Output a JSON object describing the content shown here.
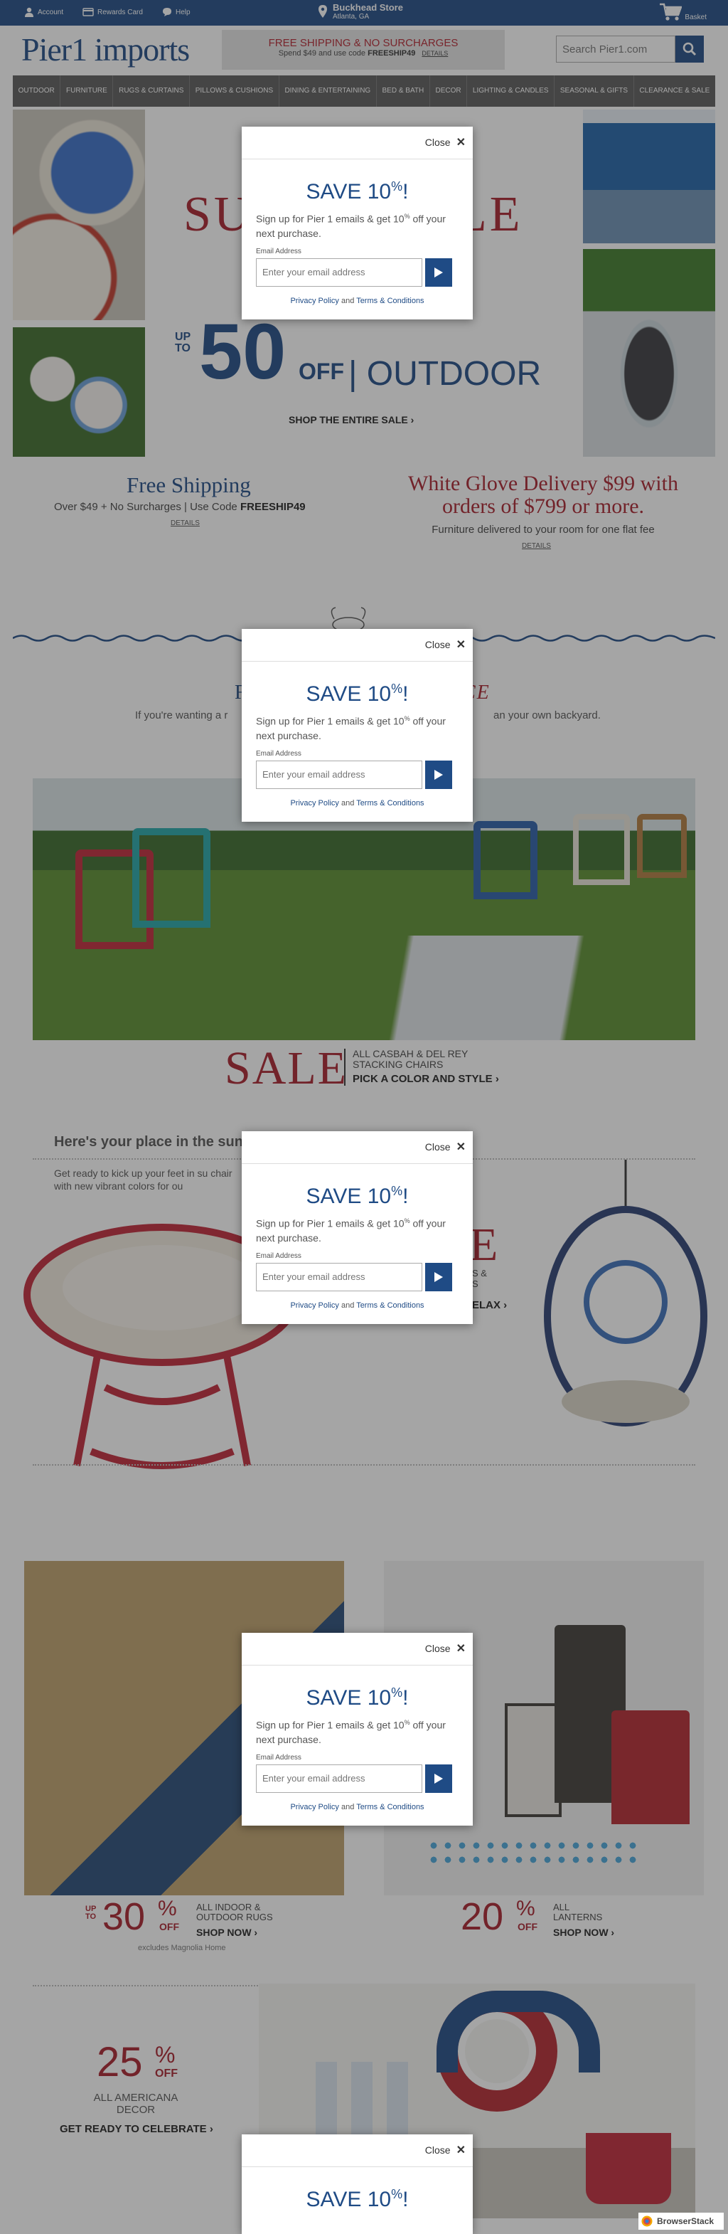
{
  "utilbar": {
    "account": "Account",
    "rewards": "Rewards Card",
    "help": "Help",
    "store_name": "Buckhead Store",
    "store_city": "Atlanta, GA",
    "basket": "Basket"
  },
  "header": {
    "logo": "Pier1 imports",
    "promo_line1": "FREE SHIPPING & NO SURCHARGES",
    "promo_line2_pre": "Spend $49 and use code",
    "promo_code": "FREESHIP49",
    "promo_details": "DETAILS",
    "search_placeholder": "Search Pier1.com"
  },
  "nav": [
    "OUTDOOR",
    "FURNITURE",
    "RUGS & CURTAINS",
    "PILLOWS & CUSHIONS",
    "DINING & ENTERTAINING",
    "BED & BATH",
    "DECOR",
    "LIGHTING & CANDLES",
    "SEASONAL & GIFTS",
    "CLEARANCE & SALE"
  ],
  "hero": {
    "word_left": "SU",
    "word_right": "LE",
    "up_to": "UP TO",
    "amount": "50",
    "off": "OFF",
    "category": "| OUTDOOR",
    "cta": "SHOP THE ENTIRE SALE ›"
  },
  "shipping": {
    "title": "Free Shipping",
    "sub_pre": "Over $49 + No Surcharges | Use Code",
    "code": "FREESHIP49",
    "details": "DETAILS"
  },
  "white_glove": {
    "title": "White Glove Delivery $99 with orders of $799 or more.",
    "sub": "Furniture delivered to your room for one flat fee",
    "details": "DETAILS"
  },
  "section2": {
    "title_a": "F",
    "title_b": "CE",
    "sub_left": "If you're wanting a r",
    "sub_right": "an your own backyard."
  },
  "chairs_sale": {
    "big": "SALE",
    "line1": "ALL CASBAH & DEL REY",
    "line2": "STACKING CHAIRS",
    "cta": "PICK A COLOR AND STYLE ›"
  },
  "sun": {
    "title": "Here's your place in the sun.",
    "sub": "Get ready to kick up your feet in su chair with new vibrant colors for ou",
    "promo_big": "E",
    "promo_l1": "S &",
    "promo_l2": "S",
    "promo_cta": "ELAX ›"
  },
  "rugs": {
    "up_to": "UP TO",
    "amount": "30",
    "pct": "%",
    "off": "OFF",
    "category": "ALL INDOOR & OUTDOOR RUGS",
    "cta": "SHOP NOW ›",
    "exclusion": "excludes Magnolia Home"
  },
  "lanterns": {
    "amount": "20",
    "pct": "%",
    "off": "OFF",
    "category": "ALL LANTERNS",
    "cta": "SHOP NOW ›"
  },
  "americana": {
    "amount": "25",
    "pct": "%",
    "off": "OFF",
    "category": "ALL AMERICANA DECOR",
    "cta": "GET READY TO CELEBRATE ›"
  },
  "modal": {
    "close": "Close",
    "title": "SAVE 10",
    "title_sup": "%",
    "title_end": "!",
    "text_pre": "Sign up for Pier 1 emails & get 10",
    "text_sup": "%",
    "text_post": " off your next purchase.",
    "email_label": "Email Address",
    "email_placeholder": "Enter your email address",
    "privacy": "Privacy Policy",
    "and": "and",
    "terms": "Terms & Conditions"
  },
  "browserstack": "BrowserStack",
  "colors": {
    "brand_blue": "#1f4b85",
    "accent_red": "#a81f2c",
    "nav_gray": "#5a5a5a"
  }
}
